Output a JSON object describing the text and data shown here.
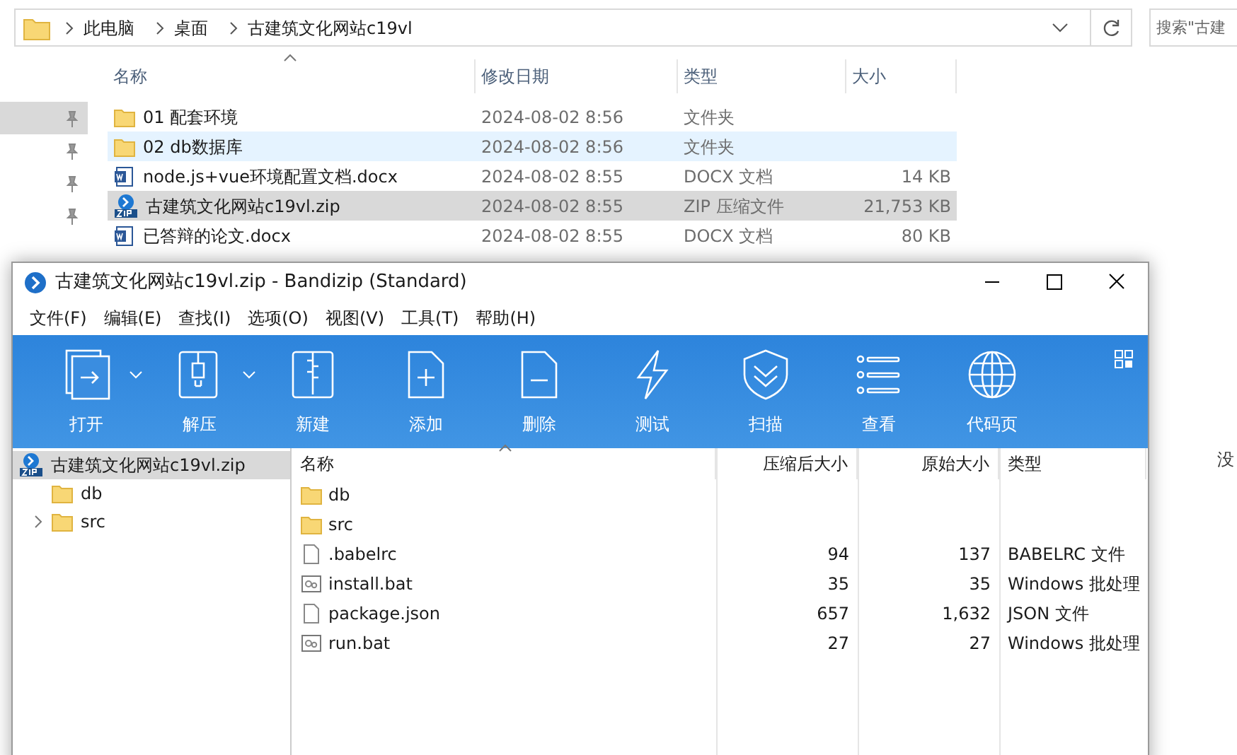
{
  "explorer": {
    "breadcrumb": [
      "此电脑",
      "桌面",
      "古建筑文化网站c19vl"
    ],
    "search": {
      "placeholder": "搜索\"古建"
    },
    "columns": [
      "名称",
      "修改日期",
      "类型",
      "大小"
    ],
    "pins": [
      {
        "selected": true
      },
      {
        "selected": false
      },
      {
        "selected": false
      },
      {
        "selected": false
      }
    ],
    "rows": [
      {
        "name": "01  配套环境",
        "date": "2024-08-02 8:56",
        "type": "文件夹",
        "size": "",
        "kind": "folder",
        "selected": false,
        "hovered": false
      },
      {
        "name": "02 db数据库",
        "date": "2024-08-02 8:56",
        "type": "文件夹",
        "size": "",
        "kind": "folder",
        "selected": false,
        "hovered": true
      },
      {
        "name": "node.js+vue环境配置文档.docx",
        "date": "2024-08-02 8:55",
        "type": "DOCX 文档",
        "size": "14 KB",
        "kind": "word",
        "selected": false,
        "hovered": false
      },
      {
        "name": "古建筑文化网站c19vl.zip",
        "date": "2024-08-02 8:55",
        "type": "ZIP 压缩文件",
        "size": "21,753 KB",
        "kind": "zip",
        "selected": true,
        "hovered": false
      },
      {
        "name": "已答辩的论文.docx",
        "date": "2024-08-02 8:55",
        "type": "DOCX 文档",
        "size": "80 KB",
        "kind": "word",
        "selected": false,
        "hovered": false
      }
    ],
    "background_fragments": [
      "没"
    ]
  },
  "bandizip": {
    "title": "古建筑文化网站c19vl.zip - Bandizip (Standard)",
    "menu": [
      "文件(F)",
      "编辑(E)",
      "查找(I)",
      "选项(O)",
      "视图(V)",
      "工具(T)",
      "帮助(H)"
    ],
    "toolbar": [
      {
        "label": "打开",
        "kind": "open",
        "dropdown": true
      },
      {
        "label": "解压",
        "kind": "extract",
        "dropdown": true
      },
      {
        "label": "新建",
        "kind": "new",
        "dropdown": false
      },
      {
        "label": "添加",
        "kind": "add",
        "dropdown": false
      },
      {
        "label": "删除",
        "kind": "delete",
        "dropdown": false
      },
      {
        "label": "测试",
        "kind": "test",
        "dropdown": false
      },
      {
        "label": "扫描",
        "kind": "scan",
        "dropdown": false
      },
      {
        "label": "查看",
        "kind": "view",
        "dropdown": false
      },
      {
        "label": "代码页",
        "kind": "codepage",
        "dropdown": false
      }
    ],
    "tree": [
      {
        "label": "古建筑文化网站c19vl.zip",
        "kind": "zip",
        "selected": true,
        "children": [
          {
            "label": "db",
            "kind": "folder",
            "selected": false,
            "expandable": false
          },
          {
            "label": "src",
            "kind": "folder",
            "selected": false,
            "expandable": true
          }
        ]
      }
    ],
    "columns": [
      "名称",
      "压缩后大小",
      "原始大小",
      "类型"
    ],
    "rows": [
      {
        "name": "db",
        "packed": "",
        "size": "",
        "type": "",
        "kind": "folder"
      },
      {
        "name": "src",
        "packed": "",
        "size": "",
        "type": "",
        "kind": "folder"
      },
      {
        "name": ".babelrc",
        "packed": "94",
        "size": "137",
        "type": "BABELRC 文件",
        "kind": "file"
      },
      {
        "name": "install.bat",
        "packed": "35",
        "size": "35",
        "type": "Windows 批处理",
        "kind": "bat"
      },
      {
        "name": "package.json",
        "packed": "657",
        "size": "1,632",
        "type": "JSON 文件",
        "kind": "file"
      },
      {
        "name": "run.bat",
        "packed": "27",
        "size": "27",
        "type": "Windows 批处理",
        "kind": "bat"
      }
    ]
  }
}
